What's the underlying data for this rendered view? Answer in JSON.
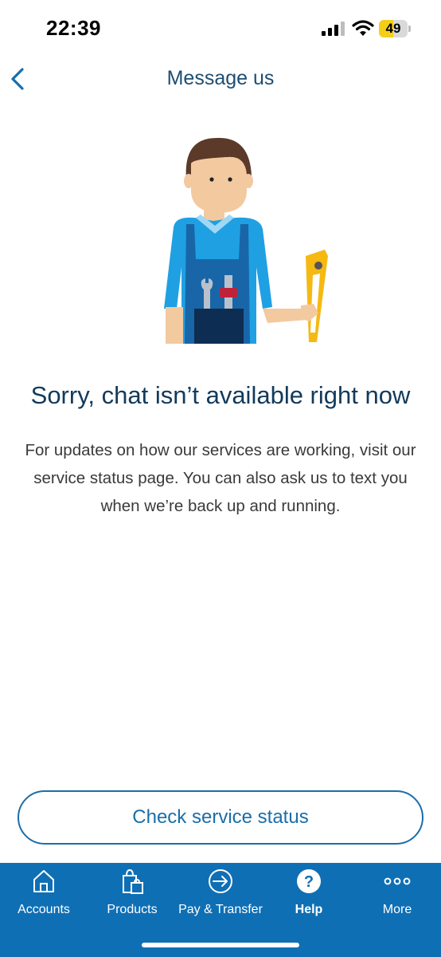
{
  "status": {
    "time": "22:39",
    "battery": "49",
    "battery_level": 0.49
  },
  "header": {
    "title": "Message us",
    "back_icon": "chevron-left-icon"
  },
  "message": {
    "heading": "Sorry, chat isn’t available right now",
    "body": "For updates on how our services are working, visit our service status page. You can also ask us to text you when we’re back up and running."
  },
  "actions": {
    "check_status": "Check service status"
  },
  "tabs": [
    {
      "label": "Accounts",
      "icon": "home-icon"
    },
    {
      "label": "Products",
      "icon": "shopping-bag-icon"
    },
    {
      "label": "Pay & Transfer",
      "icon": "arrow-circle-icon"
    },
    {
      "label": "Help",
      "icon": "help-circle-icon",
      "active": true
    },
    {
      "label": "More",
      "icon": "more-icon"
    }
  ],
  "colors": {
    "primary": "#0f6fb5",
    "title": "#1d4d72",
    "heading": "#123a5b",
    "battery": "#f4cf1a"
  }
}
